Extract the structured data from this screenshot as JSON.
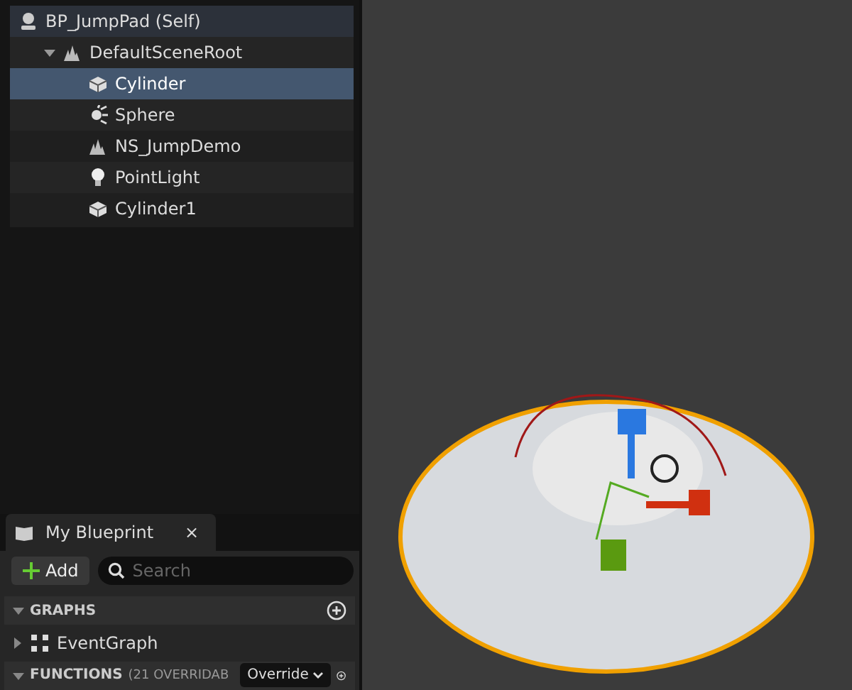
{
  "components": {
    "root": {
      "label": "BP_JumpPad (Self)",
      "kind": "self",
      "children": [
        {
          "label": "DefaultSceneRoot",
          "kind": "scene",
          "expanded": true,
          "selected": false,
          "children": [
            {
              "label": "Cylinder",
              "kind": "mesh",
              "selected": true
            },
            {
              "label": "Sphere",
              "kind": "burst",
              "selected": false
            },
            {
              "label": "NS_JumpDemo",
              "kind": "scene",
              "selected": false
            },
            {
              "label": "PointLight",
              "kind": "light",
              "selected": false
            },
            {
              "label": "Cylinder1",
              "kind": "mesh",
              "selected": false
            }
          ]
        }
      ]
    }
  },
  "my_blueprint": {
    "tab": {
      "label": "My Blueprint",
      "close": "×"
    },
    "add_button": "Add",
    "search": {
      "placeholder": "Search"
    },
    "sections": [
      {
        "title": "GRAPHS",
        "expanded": true,
        "items": [
          {
            "label": "EventGraph",
            "expanded": false
          }
        ]
      },
      {
        "title": "FUNCTIONS",
        "count": "(21 OVERRIDAB",
        "dropdown": "Override",
        "expanded": true
      }
    ]
  }
}
